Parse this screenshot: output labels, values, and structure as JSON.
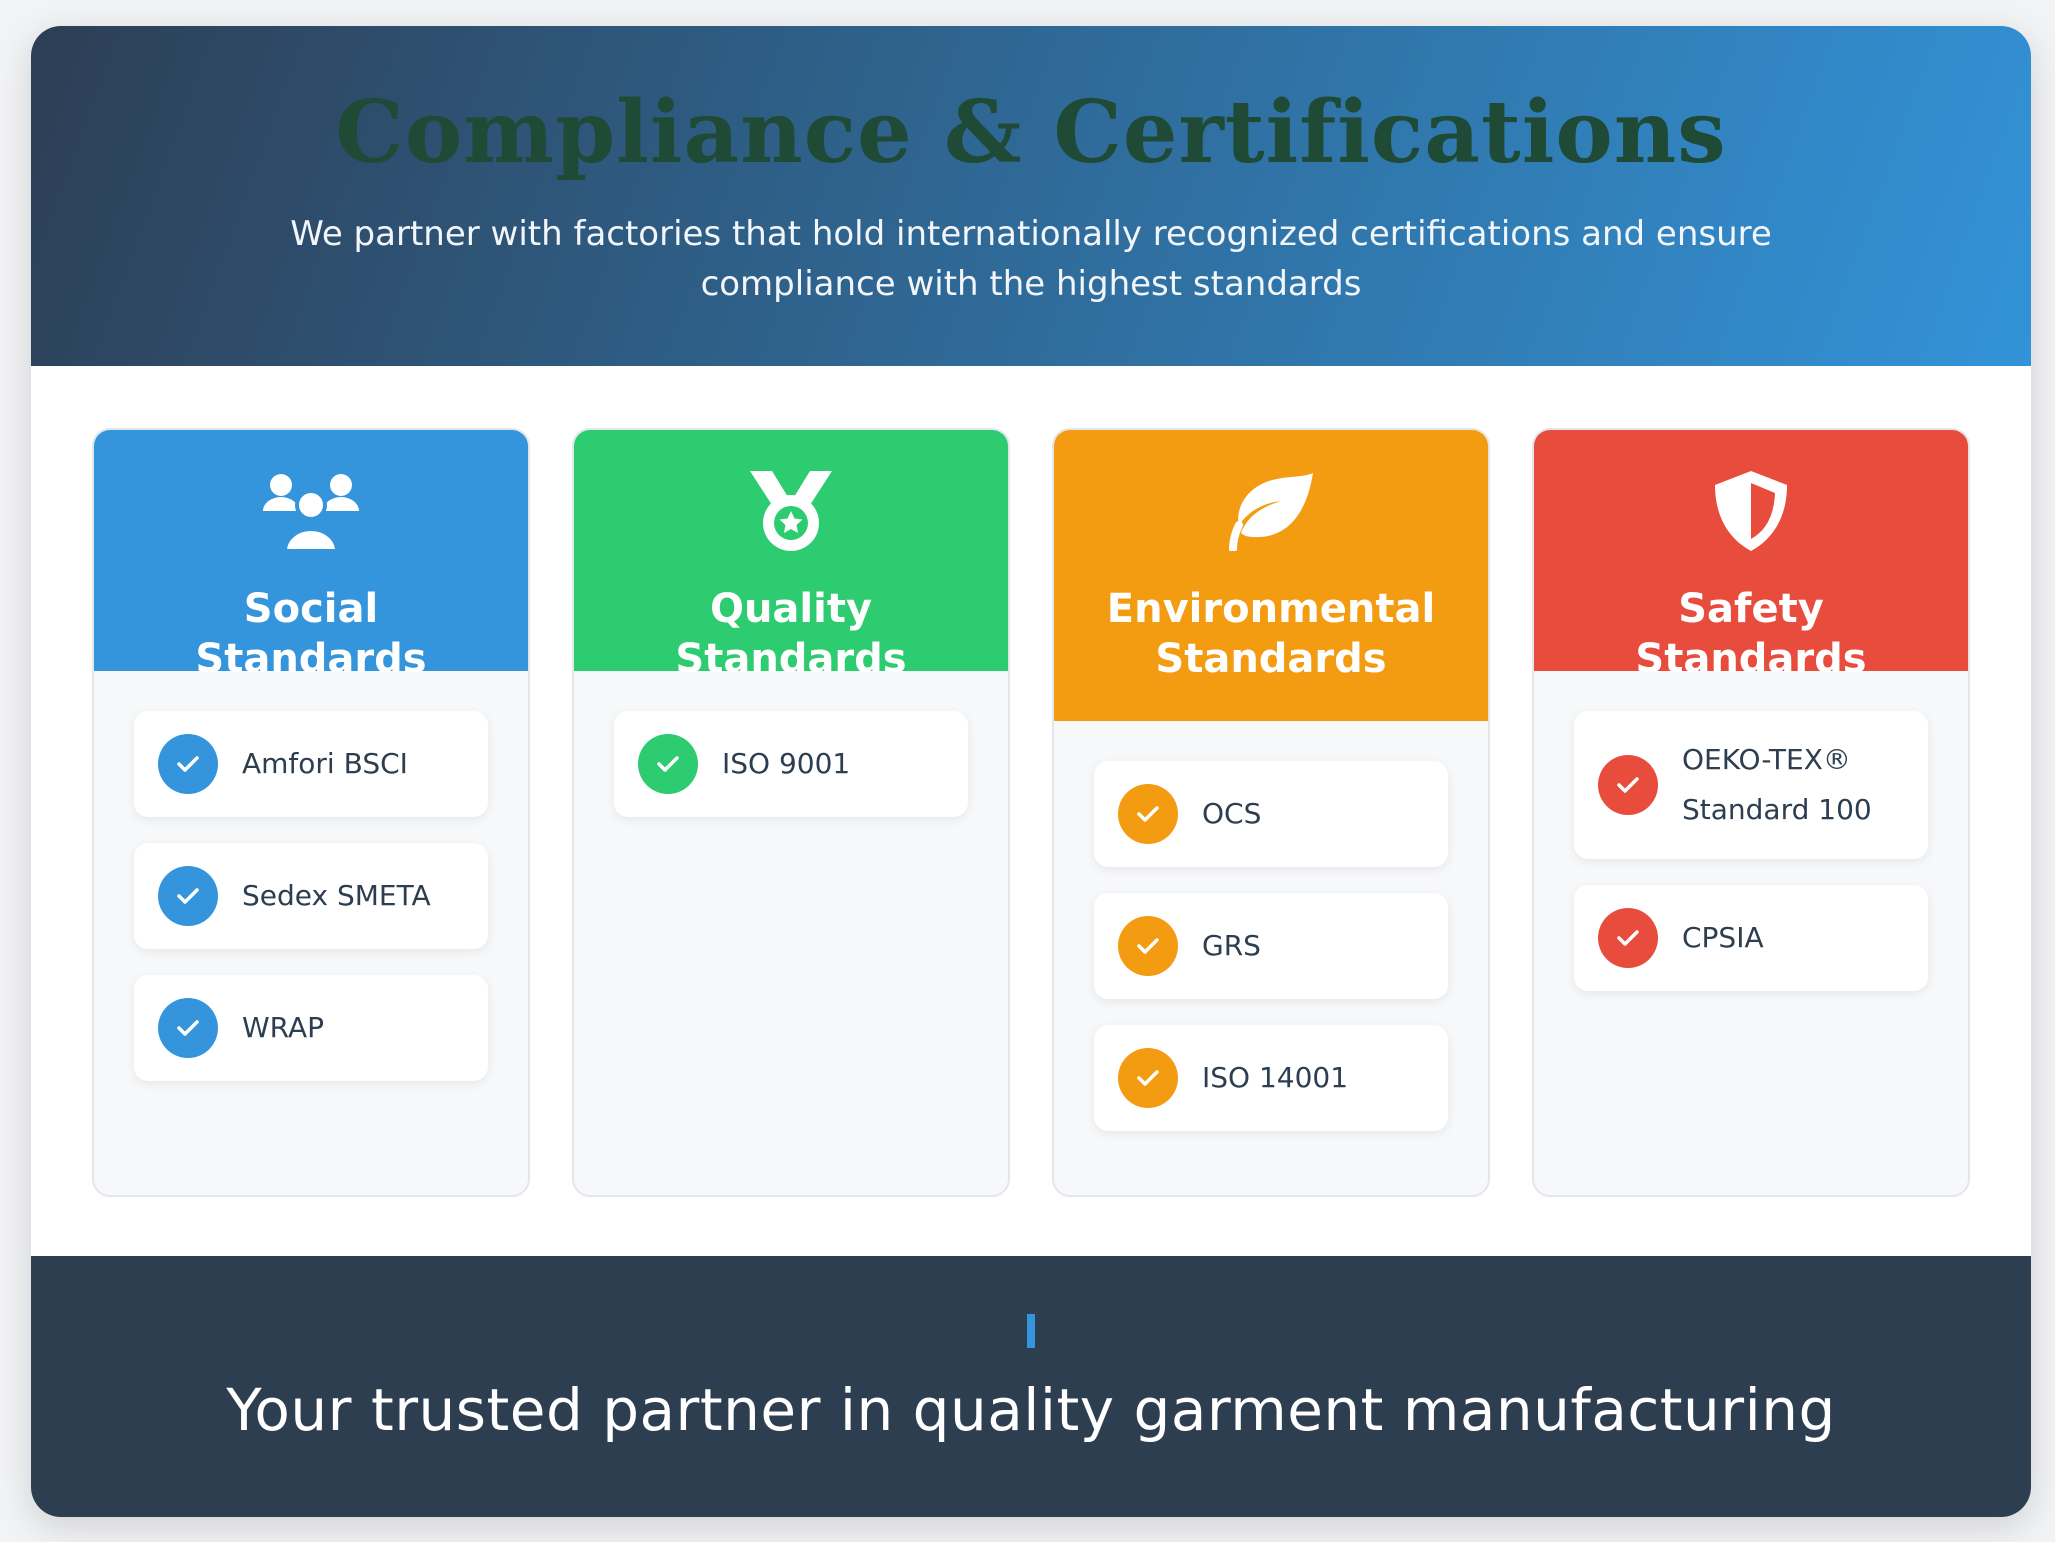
{
  "hero": {
    "title": "Compliance & Certifications",
    "subtitle": "We partner with factories that hold internationally recognized certifications and ensure compliance with the highest standards"
  },
  "cards": [
    {
      "title": "Social Standards",
      "icon": "users-icon",
      "color": "#3494dc",
      "items": [
        "Amfori BSCI",
        "Sedex SMETA",
        "WRAP"
      ]
    },
    {
      "title": "Quality Standards",
      "icon": "medal-icon",
      "color": "#2ecc71",
      "items": [
        "ISO 9001"
      ]
    },
    {
      "title": "Environmental Standards",
      "icon": "leaf-icon",
      "color": "#f39c12",
      "items": [
        "OCS",
        "GRS",
        "ISO 14001"
      ]
    },
    {
      "title": "Safety Standards",
      "icon": "shield-icon",
      "color": "#e74c3c",
      "items": [
        "OEKO-TEX® Standard 100",
        "CPSIA"
      ]
    }
  ],
  "footer": {
    "tagline": "Your trusted partner in quality garment manufacturing"
  }
}
